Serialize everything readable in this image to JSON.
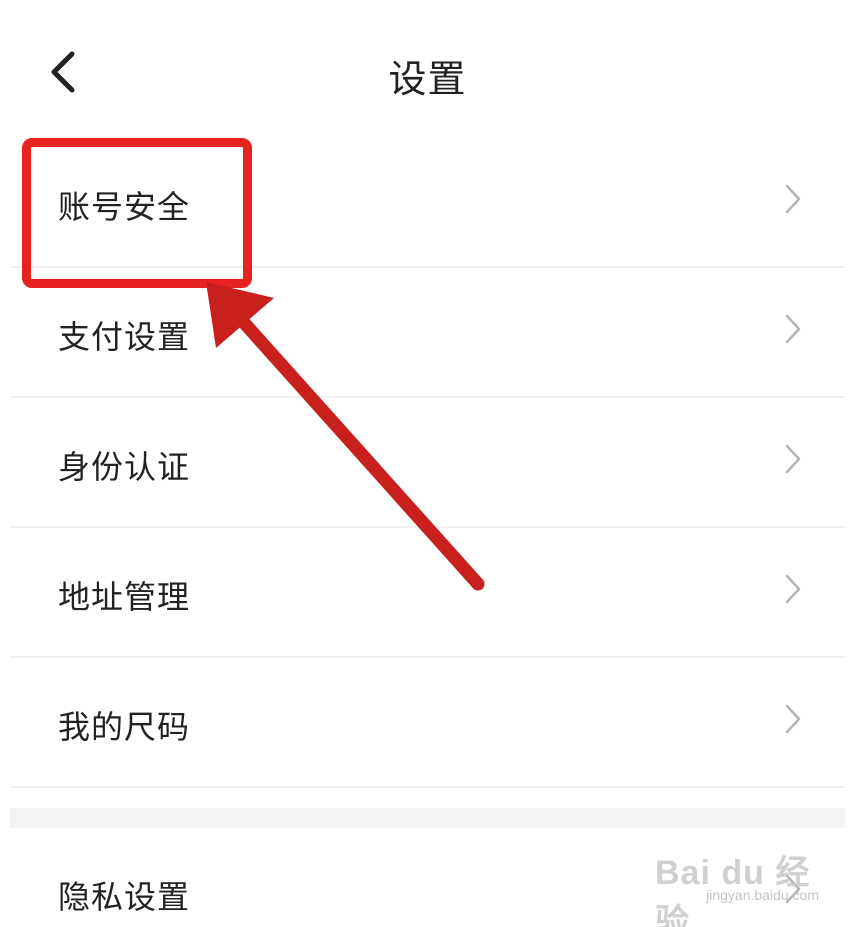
{
  "header": {
    "title": "设置"
  },
  "settings": {
    "items": [
      {
        "label": "账号安全"
      },
      {
        "label": "支付设置"
      },
      {
        "label": "身份认证"
      },
      {
        "label": "地址管理"
      },
      {
        "label": "我的尺码"
      },
      {
        "label": "隐私设置"
      }
    ]
  },
  "annotation": {
    "color": "#e8231f"
  },
  "watermark": {
    "main": "Bai du 经验",
    "sub": "jingyan.baidu.com"
  },
  "icons": {
    "back": "chevron-left-icon",
    "row": "chevron-right-icon"
  }
}
